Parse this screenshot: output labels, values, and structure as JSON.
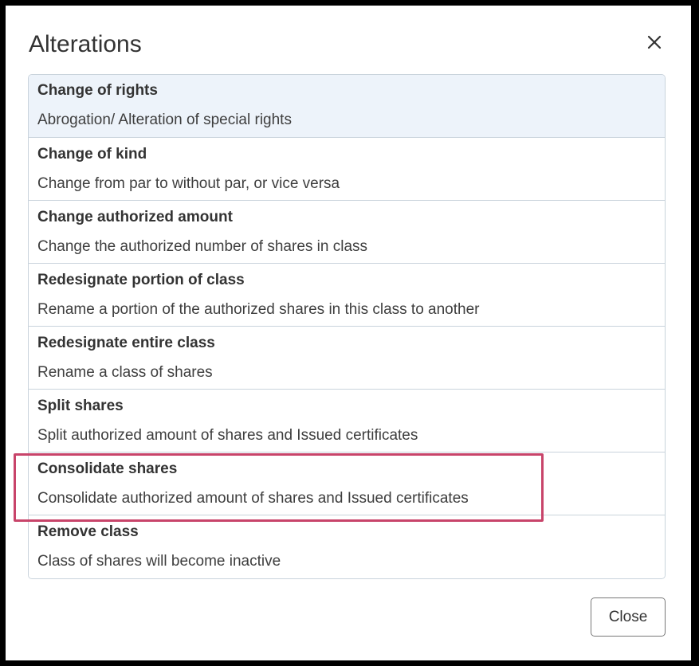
{
  "dialog": {
    "title": "Alterations",
    "close_icon": "close-icon",
    "close_button_label": "Close"
  },
  "alterations": [
    {
      "title": "Change of rights",
      "description": "Abrogation/ Alteration of special rights",
      "active": true
    },
    {
      "title": "Change of kind",
      "description": "Change from par to without par, or vice versa"
    },
    {
      "title": "Change authorized amount",
      "description": "Change the authorized number of shares in class"
    },
    {
      "title": "Redesignate portion of class",
      "description": "Rename a portion of the authorized shares in this class to another"
    },
    {
      "title": "Redesignate entire class",
      "description": "Rename a class of shares"
    },
    {
      "title": "Split shares",
      "description": "Split authorized amount of shares and Issued certificates"
    },
    {
      "title": "Consolidate shares",
      "description": "Consolidate authorized amount of shares and Issued certificates",
      "highlighted": true
    },
    {
      "title": "Remove class",
      "description": "Class of shares will become inactive"
    }
  ],
  "colors": {
    "active_item_background": "#edf3fa",
    "highlight_border": "#c8446a",
    "list_border": "#c9d3dc"
  }
}
